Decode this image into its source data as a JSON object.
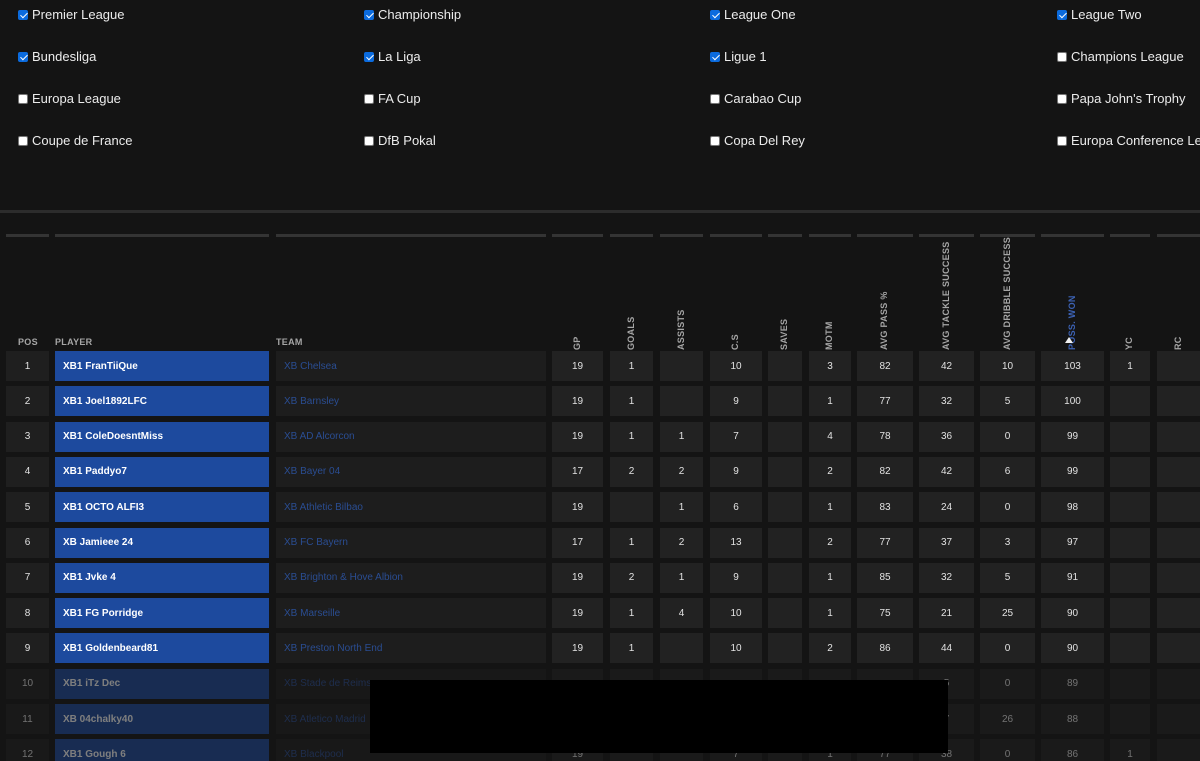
{
  "filters": [
    {
      "label": "Premier League",
      "checked": true
    },
    {
      "label": "Championship",
      "checked": true
    },
    {
      "label": "League One",
      "checked": true
    },
    {
      "label": "League Two",
      "checked": true
    },
    {
      "label": "Bundesliga",
      "checked": true
    },
    {
      "label": "La Liga",
      "checked": true
    },
    {
      "label": "Ligue 1",
      "checked": true
    },
    {
      "label": "Champions League",
      "checked": false
    },
    {
      "label": "Europa League",
      "checked": false
    },
    {
      "label": "FA Cup",
      "checked": false
    },
    {
      "label": "Carabao Cup",
      "checked": false
    },
    {
      "label": "Papa John's Trophy",
      "checked": false
    },
    {
      "label": "Coupe de France",
      "checked": false
    },
    {
      "label": "DfB Pokal",
      "checked": false
    },
    {
      "label": "Copa Del Rey",
      "checked": false
    },
    {
      "label": "Europa Conference League",
      "checked": false
    }
  ],
  "table": {
    "columns": [
      {
        "key": "pos",
        "label": "POS"
      },
      {
        "key": "player",
        "label": "PLAYER"
      },
      {
        "key": "team",
        "label": "TEAM"
      },
      {
        "key": "gp",
        "label": "GP"
      },
      {
        "key": "goals",
        "label": "GOALS"
      },
      {
        "key": "assists",
        "label": "ASSISTS"
      },
      {
        "key": "cs",
        "label": "C.S"
      },
      {
        "key": "saves",
        "label": "SAVES"
      },
      {
        "key": "motm",
        "label": "MOTM"
      },
      {
        "key": "avg_pass",
        "label": "AVG PASS %"
      },
      {
        "key": "avg_tackle",
        "label": "AVG TACKLE SUCCESS"
      },
      {
        "key": "avg_dribble",
        "label": "AVG DRIBBLE SUCCESS"
      },
      {
        "key": "poss_won",
        "label": "POSS. WON",
        "sorted": "desc"
      },
      {
        "key": "yc",
        "label": "YC"
      },
      {
        "key": "rc",
        "label": "RC"
      }
    ],
    "rows": [
      {
        "pos": "1",
        "player": "XB1 FranTiiQue",
        "team": "XB Chelsea",
        "gp": "19",
        "goals": "1",
        "assists": "",
        "cs": "10",
        "saves": "",
        "motm": "3",
        "avg_pass": "82",
        "avg_tackle": "42",
        "avg_dribble": "10",
        "poss_won": "103",
        "yc": "1",
        "rc": ""
      },
      {
        "pos": "2",
        "player": "XB1 Joel1892LFC",
        "team": "XB Barnsley",
        "gp": "19",
        "goals": "1",
        "assists": "",
        "cs": "9",
        "saves": "",
        "motm": "1",
        "avg_pass": "77",
        "avg_tackle": "32",
        "avg_dribble": "5",
        "poss_won": "100",
        "yc": "",
        "rc": ""
      },
      {
        "pos": "3",
        "player": "XB1 ColeDoesntMiss",
        "team": "XB AD Alcorcon",
        "gp": "19",
        "goals": "1",
        "assists": "1",
        "cs": "7",
        "saves": "",
        "motm": "4",
        "avg_pass": "78",
        "avg_tackle": "36",
        "avg_dribble": "0",
        "poss_won": "99",
        "yc": "",
        "rc": ""
      },
      {
        "pos": "4",
        "player": "XB1 Paddyo7",
        "team": "XB Bayer 04",
        "gp": "17",
        "goals": "2",
        "assists": "2",
        "cs": "9",
        "saves": "",
        "motm": "2",
        "avg_pass": "82",
        "avg_tackle": "42",
        "avg_dribble": "6",
        "poss_won": "99",
        "yc": "",
        "rc": ""
      },
      {
        "pos": "5",
        "player": "XB1 OCTO ALFI3",
        "team": "XB Athletic Bilbao",
        "gp": "19",
        "goals": "",
        "assists": "1",
        "cs": "6",
        "saves": "",
        "motm": "1",
        "avg_pass": "83",
        "avg_tackle": "24",
        "avg_dribble": "0",
        "poss_won": "98",
        "yc": "",
        "rc": ""
      },
      {
        "pos": "6",
        "player": "XB Jamieee 24",
        "team": "XB FC Bayern",
        "gp": "17",
        "goals": "1",
        "assists": "2",
        "cs": "13",
        "saves": "",
        "motm": "2",
        "avg_pass": "77",
        "avg_tackle": "37",
        "avg_dribble": "3",
        "poss_won": "97",
        "yc": "",
        "rc": ""
      },
      {
        "pos": "7",
        "player": "XB1 Jvke 4",
        "team": "XB Brighton & Hove Albion",
        "gp": "19",
        "goals": "2",
        "assists": "1",
        "cs": "9",
        "saves": "",
        "motm": "1",
        "avg_pass": "85",
        "avg_tackle": "32",
        "avg_dribble": "5",
        "poss_won": "91",
        "yc": "",
        "rc": ""
      },
      {
        "pos": "8",
        "player": "XB1 FG Porridge",
        "team": "XB Marseille",
        "gp": "19",
        "goals": "1",
        "assists": "4",
        "cs": "10",
        "saves": "",
        "motm": "1",
        "avg_pass": "75",
        "avg_tackle": "21",
        "avg_dribble": "25",
        "poss_won": "90",
        "yc": "",
        "rc": ""
      },
      {
        "pos": "9",
        "player": "XB1 Goldenbeard81",
        "team": "XB Preston North End",
        "gp": "19",
        "goals": "1",
        "assists": "",
        "cs": "10",
        "saves": "",
        "motm": "2",
        "avg_pass": "86",
        "avg_tackle": "44",
        "avg_dribble": "0",
        "poss_won": "90",
        "yc": "",
        "rc": ""
      },
      {
        "pos": "10",
        "player": "XB1 iTz Dec",
        "team": "XB Stade de Reims",
        "gp": "",
        "goals": "",
        "assists": "",
        "cs": "",
        "saves": "",
        "motm": "",
        "avg_pass": "",
        "avg_tackle": "5",
        "avg_dribble": "0",
        "poss_won": "89",
        "yc": "",
        "rc": ""
      },
      {
        "pos": "11",
        "player": "XB 04chalky40",
        "team": "XB Atletico Madrid",
        "gp": "",
        "goals": "",
        "assists": "",
        "cs": "",
        "saves": "",
        "motm": "",
        "avg_pass": "",
        "avg_tackle": "7",
        "avg_dribble": "26",
        "poss_won": "88",
        "yc": "",
        "rc": ""
      },
      {
        "pos": "12",
        "player": "XB1 Gough 6",
        "team": "XB Blackpool",
        "gp": "19",
        "goals": "",
        "assists": "",
        "cs": "7",
        "saves": "",
        "motm": "1",
        "avg_pass": "77",
        "avg_tackle": "38",
        "avg_dribble": "0",
        "poss_won": "86",
        "yc": "1",
        "rc": ""
      }
    ]
  },
  "colors": {
    "background": "#161616",
    "player_cell": "#1d4a9e",
    "team_link": "#2a4d92",
    "checkbox_checked": "#0b6bde",
    "sorted_header": "#3c62b4"
  },
  "icons": {
    "sort": "sort-desc-arrow-icon",
    "checkbox": "checkbox-icon"
  }
}
